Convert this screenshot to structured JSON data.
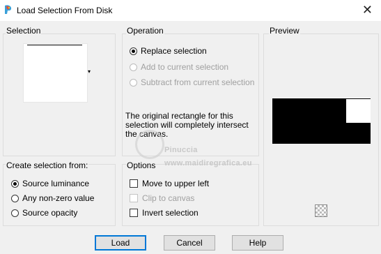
{
  "window": {
    "title": "Load Selection From Disk",
    "close_glyph": "✕"
  },
  "selection": {
    "label": "Selection",
    "dropdown_glyph": "▾"
  },
  "operation": {
    "label": "Operation",
    "options": [
      {
        "label": "Replace selection",
        "checked": true,
        "enabled": true
      },
      {
        "label": "Add to current selection",
        "checked": false,
        "enabled": false
      },
      {
        "label": "Subtract from current selection",
        "checked": false,
        "enabled": false
      }
    ],
    "description_lines": [
      "The original rectangle for this",
      "selection will completely intersect",
      "the canvas."
    ]
  },
  "preview": {
    "label": "Preview"
  },
  "create_from": {
    "label": "Create selection from:",
    "options": [
      {
        "label": "Source luminance",
        "checked": true
      },
      {
        "label": "Any non-zero value",
        "checked": false
      },
      {
        "label": "Source opacity",
        "checked": false
      }
    ]
  },
  "options": {
    "label": "Options",
    "items": [
      {
        "label": "Move to upper left",
        "checked": false,
        "enabled": true
      },
      {
        "label": "Clip to canvas",
        "checked": false,
        "enabled": false
      },
      {
        "label": "Invert selection",
        "checked": false,
        "enabled": true
      }
    ]
  },
  "watermark": {
    "name": "Pinuccia",
    "url": "www.maidiregrafica.eu"
  },
  "buttons": {
    "load": "Load",
    "cancel": "Cancel",
    "help": "Help"
  },
  "colors": {
    "accent": "#0078d7",
    "window_bg": "#f0f0f0"
  }
}
